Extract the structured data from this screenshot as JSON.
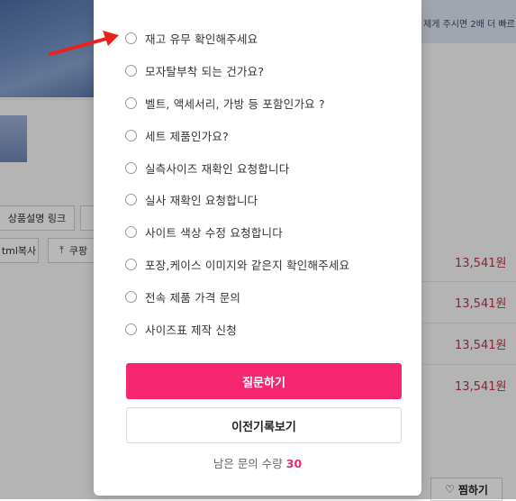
{
  "background": {
    "notice_text": "제게 주시면 2배 더 빠르",
    "buttons": {
      "product_desc_link": "상품설명 링크",
      "html_copy": "tml복사",
      "coupang": "쿠팡"
    },
    "prices": [
      "13,541원",
      "13,541원",
      "13,541원",
      "13,541원"
    ],
    "wishlist_label": "찜하기"
  },
  "modal": {
    "options": [
      {
        "label": "재고 유무 확인해주세요"
      },
      {
        "label": "모자탈부착 되는 건가요?"
      },
      {
        "label": "벨트,  액세서리,  가방 등 포함인가요 ?"
      },
      {
        "label": "세트 제품인가요?"
      },
      {
        "label": "실측사이즈 재확인 요청합니다"
      },
      {
        "label": "실사 재확인 요청합니다"
      },
      {
        "label": "사이트 색상 수정 요청합니다"
      },
      {
        "label": "포장,케이스 이미지와 같은지 확인해주세요"
      },
      {
        "label": "전속 제품 가격 문의"
      },
      {
        "label": "사이즈표 제작 신청"
      }
    ],
    "ask_button": "질문하기",
    "history_button": "이전기록보기",
    "remaining_label": "남은 문의 수량",
    "remaining_count": "30"
  },
  "colors": {
    "accent_pink": "#f4266f",
    "price_red": "#c0324a",
    "arrow_red": "#e8231d"
  }
}
